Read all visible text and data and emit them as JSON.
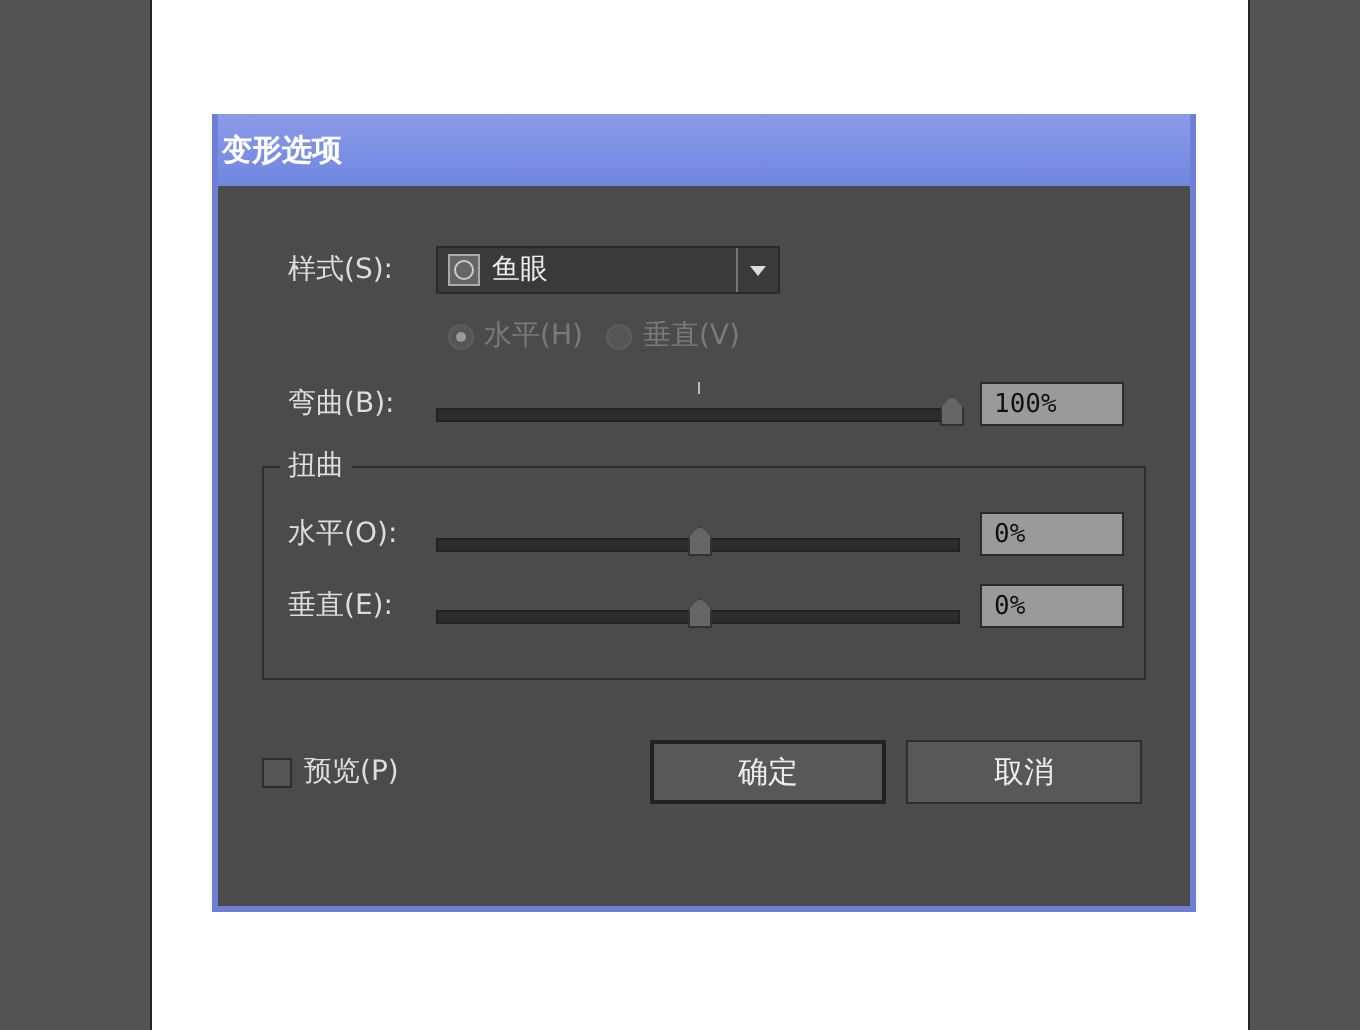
{
  "window": {
    "title": "变形选项"
  },
  "style": {
    "label": "样式(S):",
    "value": "鱼眼"
  },
  "orientation": {
    "disabled": true,
    "options": [
      {
        "label": "水平(H)",
        "selected": true
      },
      {
        "label": "垂直(V)",
        "selected": false
      }
    ]
  },
  "bend": {
    "label": "弯曲(B):",
    "level": 1,
    "value": "100%"
  },
  "distortion": {
    "title": "扭曲",
    "sliders": [
      {
        "label": "水平(O):",
        "level": 0.5,
        "value": "0%"
      },
      {
        "label": "垂直(E):",
        "level": 0.5,
        "value": "0%"
      }
    ]
  },
  "preview": {
    "label": "预览(P)",
    "checked": false
  },
  "buttons": [
    {
      "label": "确定",
      "default": true
    },
    {
      "label": "取消",
      "default": false
    }
  ]
}
